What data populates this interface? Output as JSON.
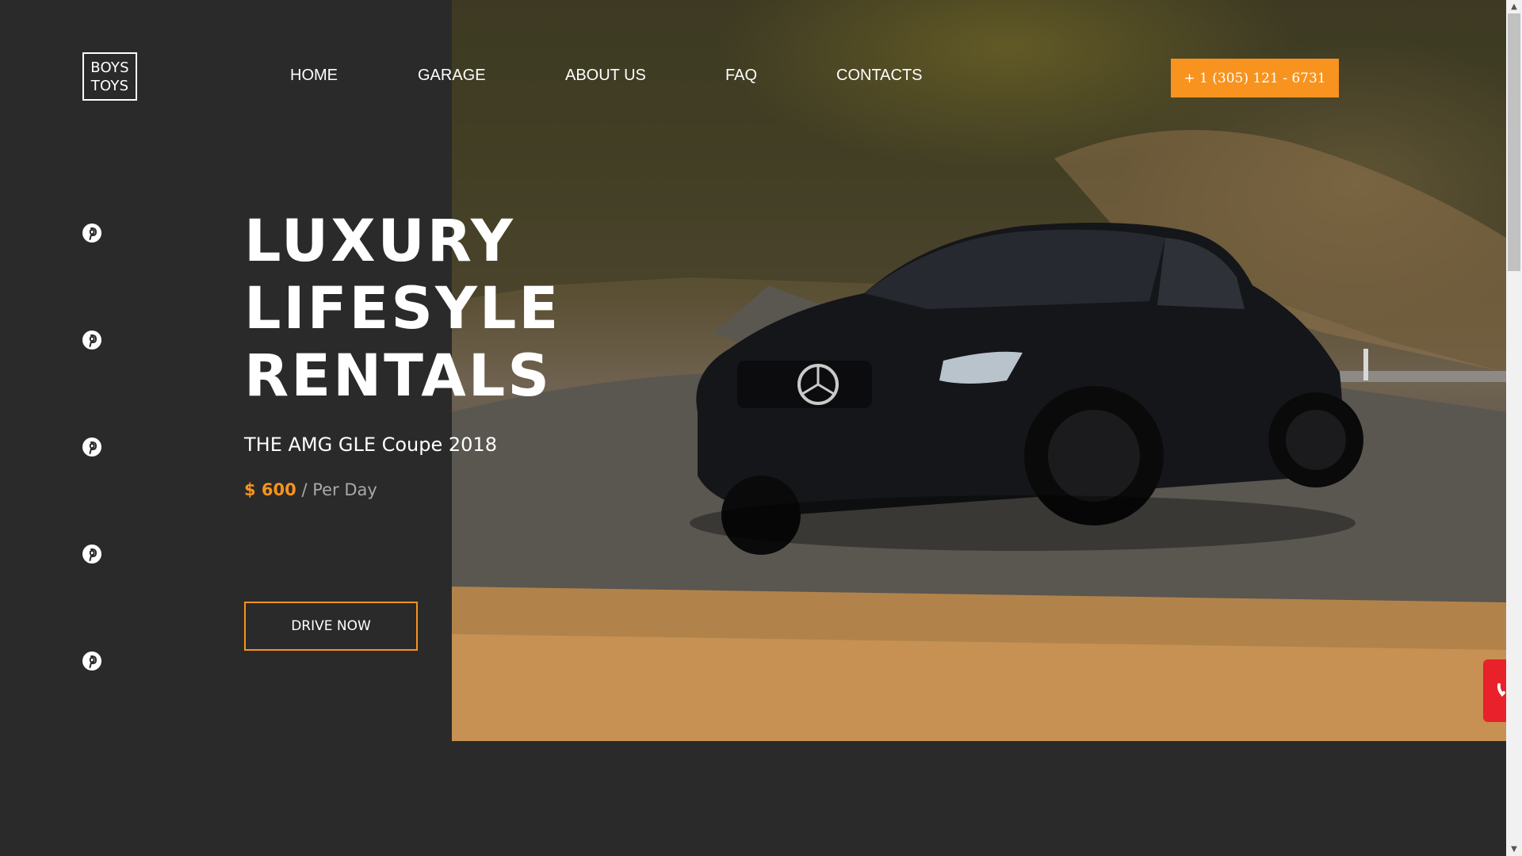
{
  "logo": {
    "line1": "BOYS",
    "line2": "TOYS"
  },
  "nav": {
    "items": [
      {
        "label": "HOME"
      },
      {
        "label": "GARAGE"
      },
      {
        "label": "ABOUT US"
      },
      {
        "label": "FAQ"
      },
      {
        "label": "CONTACTS"
      }
    ],
    "phone": "+ 1 (305) 121 - 6731"
  },
  "social": {
    "icons": [
      "pinterest-icon",
      "pinterest-icon",
      "pinterest-icon",
      "pinterest-icon",
      "pinterest-icon"
    ]
  },
  "hero": {
    "headline": [
      "LUXURY",
      "LIFESYLE",
      "RENTALS"
    ],
    "model": "THE AMG GLE Coupe 2018",
    "price": "$ 600",
    "price_unit": "/ Per Day",
    "cta_label": "DRIVE NOW"
  },
  "colors": {
    "accent": "#f7931e",
    "background": "#2a2a2a",
    "call_widget": "#e8212b"
  }
}
